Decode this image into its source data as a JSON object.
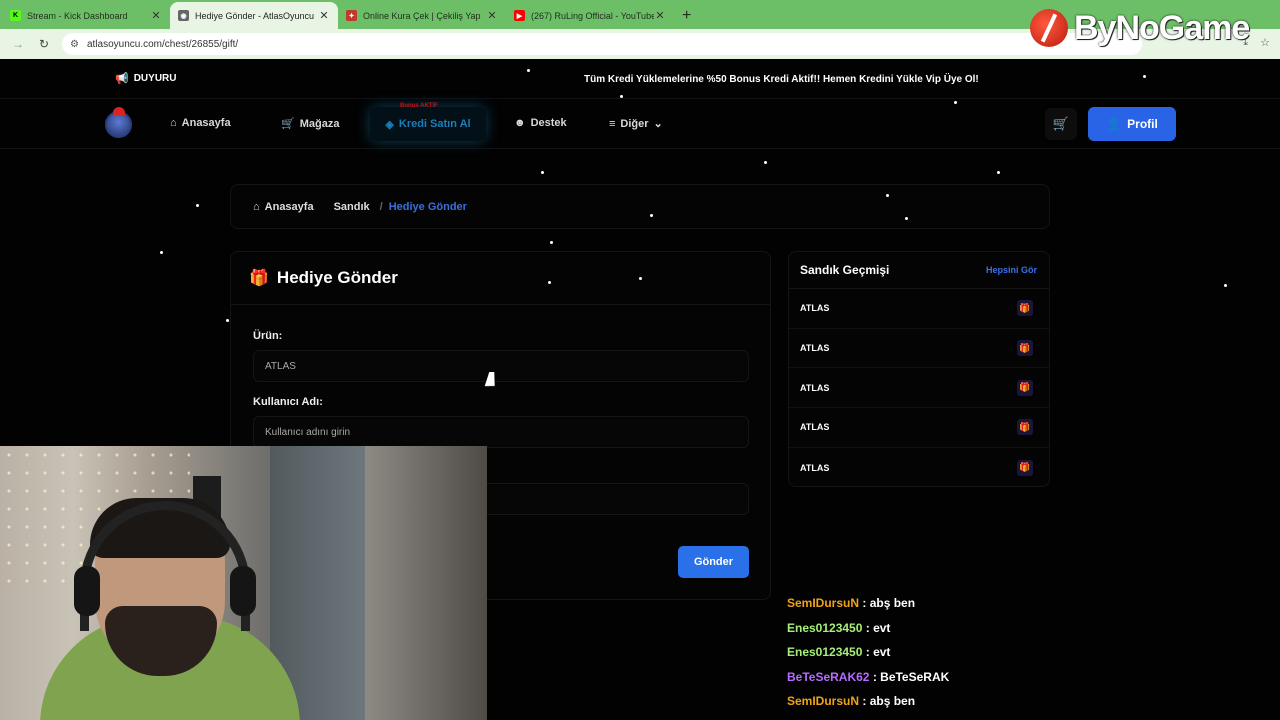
{
  "browser": {
    "tabs": [
      {
        "title": "Stream - Kick Dashboard",
        "favicon": "K",
        "color": "#53fc18"
      },
      {
        "title": "Hediye Gönder - AtlasOyuncu",
        "favicon": "",
        "color": "#666666"
      },
      {
        "title": "Online Kura Çek | Çekiliş Yap",
        "favicon": "",
        "color": "#c0392b"
      },
      {
        "title": "(267) RuLing Official - YouTube",
        "favicon": "▶",
        "color": "#ff0000"
      }
    ],
    "url": "atlasoyuncu.com/chest/26855/gift/"
  },
  "watermark": {
    "text": "ByNoGame"
  },
  "announcement": {
    "label": "DUYURU",
    "text": "Tüm Kredi Yüklemelerine %50 Bonus Kredi Aktif!! Hemen Kredini Yükle Vip Üye Ol!"
  },
  "nav": {
    "home": "Anasayfa",
    "shop": "Mağaza",
    "credit": "Kredi Satın Al",
    "credit_badge": "Bonus AKTİF",
    "support": "Destek",
    "other": "Diğer",
    "profile": "Profil"
  },
  "breadcrumb": {
    "home": "Anasayfa",
    "chest": "Sandık",
    "current": "Hediye Gönder"
  },
  "gift_form": {
    "title": "Hediye Gönder",
    "product_label": "Ürün:",
    "product_value": "ATLAS",
    "username_label": "Kullanıcı Adı:",
    "username_placeholder": "Kullanıcı adını girin",
    "submit": "Gönder"
  },
  "history": {
    "title": "Sandık Geçmişi",
    "view_all": "Hepsini Gör",
    "items": [
      "ATLAS",
      "ATLAS",
      "ATLAS",
      "ATLAS",
      "ATLAS"
    ]
  },
  "chat": [
    {
      "user": "SemIDursuN",
      "message": "abş ben"
    },
    {
      "user": "Enes0123450",
      "message": "evt"
    },
    {
      "user": "Enes0123450",
      "message": "evt"
    },
    {
      "user": "BeTeSeRAK62",
      "message": "BeTeSeRAK"
    },
    {
      "user": "SemIDursuN",
      "message": "abş ben"
    }
  ],
  "colors": {
    "accent": "#2a64e6",
    "browser_frame": "#6dbf67",
    "breadcrumb_active": "#3b6fdd"
  }
}
